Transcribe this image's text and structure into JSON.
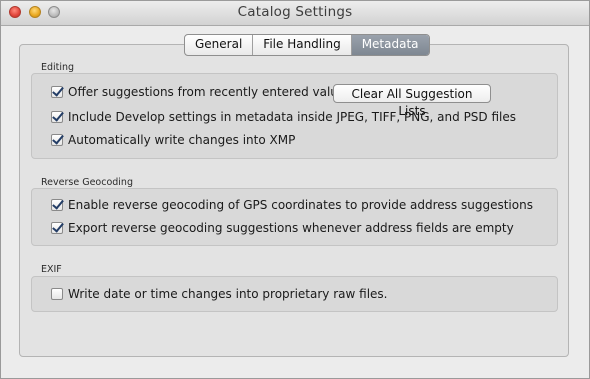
{
  "window": {
    "title": "Catalog Settings"
  },
  "tabs": [
    {
      "label": "General",
      "selected": false
    },
    {
      "label": "File Handling",
      "selected": false
    },
    {
      "label": "Metadata",
      "selected": true
    }
  ],
  "editing": {
    "label": "Editing",
    "offer_suggestions": {
      "label": "Offer suggestions from recently entered values",
      "checked": true
    },
    "clear_button": "Clear All Suggestion Lists",
    "include_develop": {
      "label": "Include Develop settings in metadata inside JPEG, TIFF, PNG, and PSD files",
      "checked": true
    },
    "auto_write": {
      "label": "Automatically write changes into XMP",
      "checked": true
    }
  },
  "reverse_geocoding": {
    "label": "Reverse Geocoding",
    "enable": {
      "label": "Enable reverse geocoding of GPS coordinates to provide address suggestions",
      "checked": true
    },
    "export": {
      "label": "Export reverse geocoding suggestions whenever address fields are empty",
      "checked": true
    }
  },
  "exif": {
    "label": "EXIF",
    "write_date": {
      "label": "Write date or time changes into proprietary raw files.",
      "checked": false
    }
  },
  "colors": {
    "window_bg": "#ececec",
    "group_bg": "#d9d9d9",
    "selected_tab": "#8a929c"
  }
}
